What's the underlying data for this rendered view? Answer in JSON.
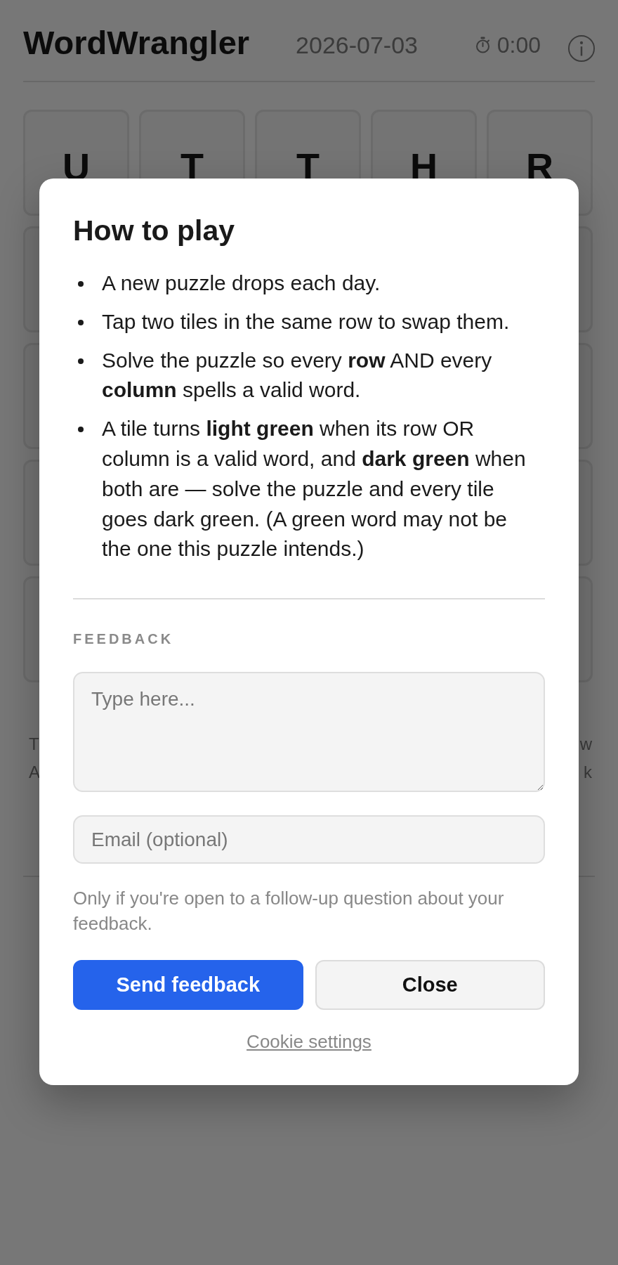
{
  "header": {
    "title": "WordWrangler",
    "date": "2026-07-03",
    "timer": "0:00"
  },
  "grid": {
    "rows": [
      {
        "covered": false,
        "tiles": [
          "U",
          "T",
          "T",
          "H",
          "R"
        ]
      },
      {
        "covered": true
      },
      {
        "covered": true
      },
      {
        "covered": true
      },
      {
        "covered": true
      }
    ]
  },
  "hint_fragments": {
    "left": [
      "T",
      "A"
    ],
    "right": [
      "w",
      "k"
    ]
  },
  "dialog": {
    "title": "How to play",
    "rules": [
      "A new puzzle drops each day.",
      "Tap two tiles in the same row to swap them.",
      "Solve the puzzle so every **row** AND every **column** spells a valid word.",
      "A tile turns **light green** when its row OR column is a valid word, and **dark green** when both are — solve the puzzle and every tile goes dark green. (A green word may not be the one this puzzle intends.)"
    ],
    "feedback": {
      "label": "FEEDBACK",
      "message_field": {
        "placeholder": "Type here..."
      },
      "email_field": {
        "placeholder": "Email (optional)"
      },
      "note": "Only if you're open to a follow-up question about your feedback."
    },
    "buttons": [
      {
        "label": "Send feedback",
        "kind": "primary"
      },
      {
        "label": "Close",
        "kind": "secondary"
      }
    ],
    "link": "Cookie settings"
  }
}
